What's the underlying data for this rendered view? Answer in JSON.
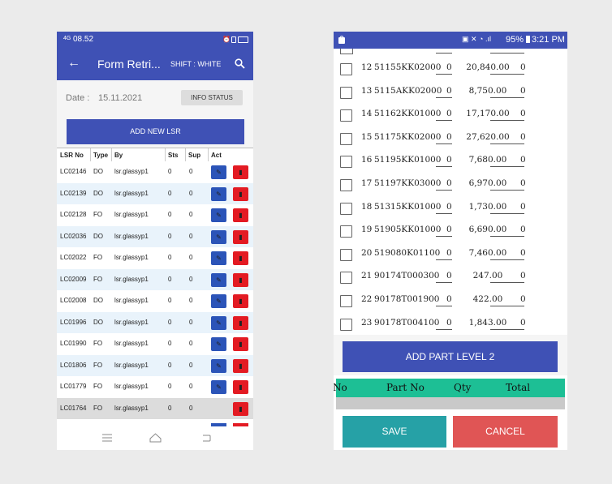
{
  "left_phone": {
    "status_time": "08.52",
    "status_network": "4G",
    "back_icon": "←",
    "title": "Form Retri...",
    "shift": "SHIFT : WHITE",
    "date_label": "Date :",
    "date_value": "15.11.2021",
    "info_status_button": "INFO STATUS",
    "add_new_button": "ADD NEW LSR",
    "columns": [
      "LSR No",
      "Type",
      "By",
      "Sts",
      "Sup",
      "Act"
    ],
    "rows": [
      {
        "lsr": "LC02146",
        "type": "DO",
        "by": "lsr.glassyp1",
        "sts": "0",
        "sup": "0",
        "edit": true
      },
      {
        "lsr": "LC02139",
        "type": "DO",
        "by": "lsr.glassyp1",
        "sts": "0",
        "sup": "0",
        "edit": true
      },
      {
        "lsr": "LC02128",
        "type": "FO",
        "by": "lsr.glassyp1",
        "sts": "0",
        "sup": "0",
        "edit": true
      },
      {
        "lsr": "LC02036",
        "type": "DO",
        "by": "lsr.glassyp1",
        "sts": "0",
        "sup": "0",
        "edit": true
      },
      {
        "lsr": "LC02022",
        "type": "FO",
        "by": "lsr.glassyp1",
        "sts": "0",
        "sup": "0",
        "edit": true
      },
      {
        "lsr": "LC02009",
        "type": "FO",
        "by": "lsr.glassyp1",
        "sts": "0",
        "sup": "0",
        "edit": true
      },
      {
        "lsr": "LC02008",
        "type": "DO",
        "by": "lsr.glassyp1",
        "sts": "0",
        "sup": "0",
        "edit": true
      },
      {
        "lsr": "LC01996",
        "type": "DO",
        "by": "lsr.glassyp1",
        "sts": "0",
        "sup": "0",
        "edit": true
      },
      {
        "lsr": "LC01990",
        "type": "FO",
        "by": "lsr.glassyp1",
        "sts": "0",
        "sup": "0",
        "edit": true
      },
      {
        "lsr": "LC01806",
        "type": "FO",
        "by": "lsr.glassyp1",
        "sts": "0",
        "sup": "0",
        "edit": true
      },
      {
        "lsr": "LC01779",
        "type": "FO",
        "by": "lsr.glassyp1",
        "sts": "0",
        "sup": "0",
        "edit": true
      },
      {
        "lsr": "LC01764",
        "type": "FO",
        "by": "lsr.glassyp1",
        "sts": "0",
        "sup": "0",
        "edit": false
      }
    ]
  },
  "right_phone": {
    "status_battery": "95%",
    "status_time": "3:21 PM",
    "parts": [
      {
        "no": "12",
        "part": "51155KK02000",
        "qty": "0",
        "price": "20,840.00",
        "total": "0"
      },
      {
        "no": "13",
        "part": "5115AKK02000",
        "qty": "0",
        "price": "8,750.00",
        "total": "0"
      },
      {
        "no": "14",
        "part": "51162KK01000",
        "qty": "0",
        "price": "17,170.00",
        "total": "0"
      },
      {
        "no": "15",
        "part": "51175KK02000",
        "qty": "0",
        "price": "27,620.00",
        "total": "0"
      },
      {
        "no": "16",
        "part": "51195KK01000",
        "qty": "0",
        "price": "7,680.00",
        "total": "0"
      },
      {
        "no": "17",
        "part": "51197KK03000",
        "qty": "0",
        "price": "6,970.00",
        "total": "0"
      },
      {
        "no": "18",
        "part": "51315KK01000",
        "qty": "0",
        "price": "1,730.00",
        "total": "0"
      },
      {
        "no": "19",
        "part": "51905KK01000",
        "qty": "0",
        "price": "6,690.00",
        "total": "0"
      },
      {
        "no": "20",
        "part": "519080K01100",
        "qty": "0",
        "price": "7,460.00",
        "total": "0"
      },
      {
        "no": "21",
        "part": "90174T000300",
        "qty": "0",
        "price": "247.00",
        "total": "0"
      },
      {
        "no": "22",
        "part": "90178T001900",
        "qty": "0",
        "price": "422.00",
        "total": "0"
      },
      {
        "no": "23",
        "part": "90178T004100",
        "qty": "0",
        "price": "1,843.00",
        "total": "0"
      }
    ],
    "add_part_button": "ADD PART LEVEL 2",
    "table_headers": [
      "No",
      "Part No",
      "Qty",
      "Total"
    ],
    "save_button": "SAVE",
    "cancel_button": "CANCEL"
  }
}
